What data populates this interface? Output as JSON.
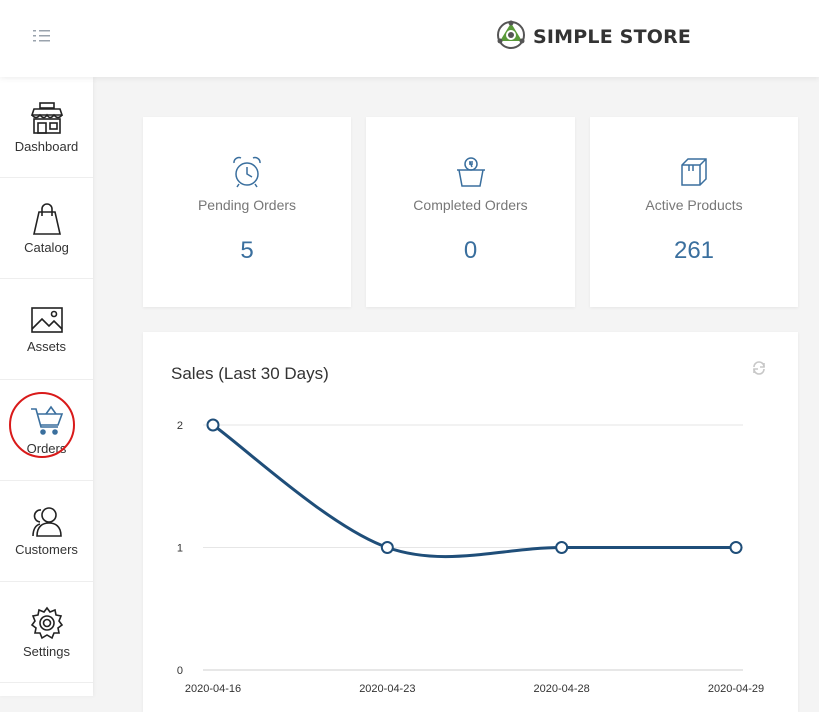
{
  "header": {
    "brand_name": "SIMPLE STORE",
    "menu_icon": "menu-icon",
    "logo_icon": "store-logo-icon"
  },
  "sidebar": {
    "items": [
      {
        "label": "Dashboard",
        "icon": "storefront-icon"
      },
      {
        "label": "Catalog",
        "icon": "shopping-bag-icon"
      },
      {
        "label": "Assets",
        "icon": "image-icon"
      },
      {
        "label": "Orders",
        "icon": "cart-icon",
        "highlighted": true
      },
      {
        "label": "Customers",
        "icon": "users-icon"
      },
      {
        "label": "Settings",
        "icon": "gear-icon"
      }
    ]
  },
  "stats": [
    {
      "title": "Pending Orders",
      "value": "5",
      "icon": "alarm-clock-icon"
    },
    {
      "title": "Completed Orders",
      "value": "0",
      "icon": "money-basket-icon"
    },
    {
      "title": "Active Products",
      "value": "261",
      "icon": "box-icon"
    }
  ],
  "sales": {
    "title": "Sales (Last 30 Days)",
    "refresh_icon": "refresh-icon"
  },
  "colors": {
    "accent": "#3a6f9e",
    "line": "#1f4e79",
    "highlight": "#d91a1a",
    "logo_green": "#5a9a3a"
  },
  "chart_data": {
    "type": "line",
    "categories": [
      "2020-04-16",
      "2020-04-23",
      "2020-04-28",
      "2020-04-29"
    ],
    "series": [
      {
        "values": [
          2,
          1,
          1,
          1
        ]
      }
    ],
    "yticks": [
      "0",
      "1",
      "2"
    ],
    "ylim": [
      0,
      2
    ],
    "grid": true,
    "smooth": true
  }
}
